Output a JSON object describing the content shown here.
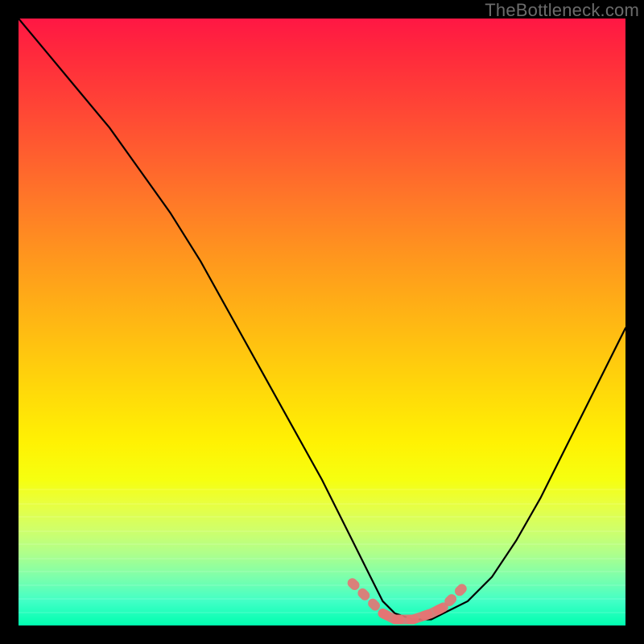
{
  "watermark": "TheBottleneck.com",
  "chart_data": {
    "type": "line",
    "title": "",
    "xlabel": "",
    "ylabel": "",
    "xlim": [
      0,
      100
    ],
    "ylim": [
      0,
      100
    ],
    "grid": false,
    "legend": false,
    "gradient_stops": [
      {
        "pos": 0,
        "color": "#ff1744"
      },
      {
        "pos": 50,
        "color": "#ffc107"
      },
      {
        "pos": 78,
        "color": "#ffff00"
      },
      {
        "pos": 100,
        "color": "#00ffb0"
      }
    ],
    "series": [
      {
        "name": "bottleneck-curve",
        "x": [
          0,
          5,
          10,
          15,
          20,
          25,
          30,
          35,
          40,
          45,
          50,
          55,
          58,
          60,
          62,
          65,
          68,
          70,
          74,
          78,
          82,
          86,
          90,
          94,
          98,
          100
        ],
        "y": [
          100,
          94,
          88,
          82,
          75,
          68,
          60,
          51,
          42,
          33,
          24,
          14,
          8,
          4,
          2,
          1,
          1,
          2,
          4,
          8,
          14,
          21,
          29,
          37,
          45,
          49
        ]
      }
    ],
    "highlight_valley": {
      "name": "optimal-range",
      "color": "#e57373",
      "x": [
        55,
        58,
        60,
        62,
        65,
        68,
        70,
        72,
        74
      ],
      "y": [
        7,
        4,
        2,
        1,
        1,
        2,
        3,
        5,
        7
      ]
    }
  }
}
